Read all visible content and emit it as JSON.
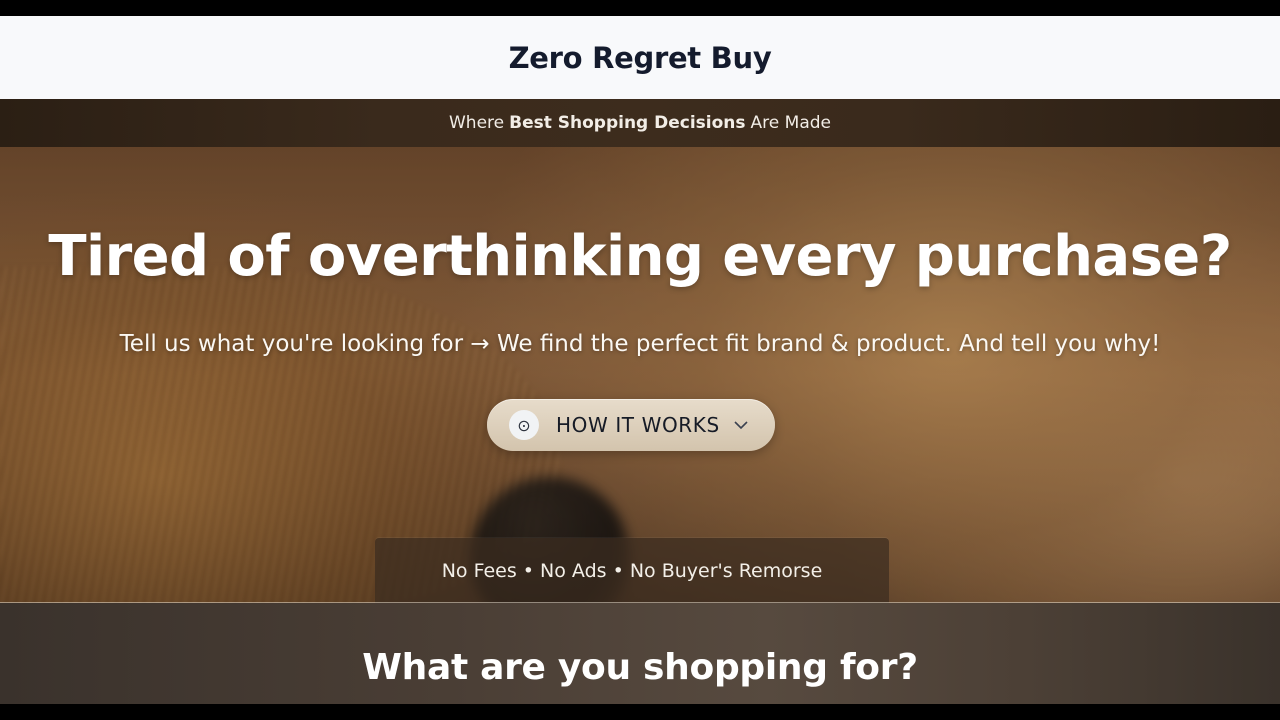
{
  "header": {
    "site_title": "Zero Regret Buy"
  },
  "tagline": {
    "prefix": "Where",
    "highlight": "Best Shopping Decisions",
    "suffix": "Are Made"
  },
  "hero": {
    "heading": "Tired of overthinking every purchase?",
    "subheading": "Tell us what you're looking for → We find the perfect fit brand & product. And tell you why!",
    "how_it_works_button": {
      "label": "HOW IT WORKS",
      "icon": "play-circle-icon",
      "chevron": "chevron-down-icon"
    },
    "perks": "No Fees • No Ads • No Buyer's Remorse"
  },
  "shopping_section": {
    "heading": "What are you shopping for?"
  },
  "colors": {
    "header_bg": "#f8f9fb",
    "title_text": "#141b2d",
    "button_bg": "#ddd0bb",
    "tagline_bg": "#33261a"
  }
}
